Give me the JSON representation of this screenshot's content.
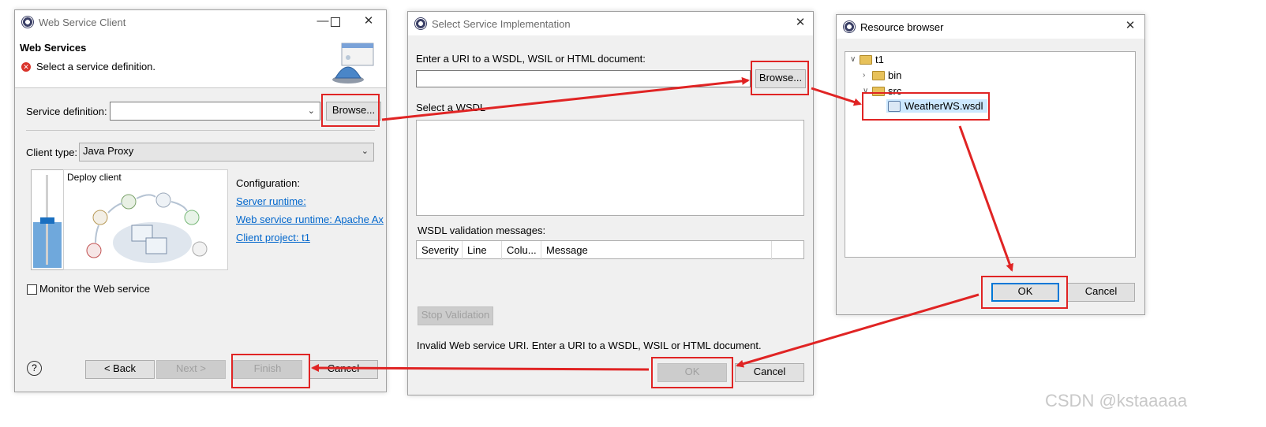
{
  "dialog1": {
    "title": "Web Service Client",
    "heading": "Web Services",
    "message": "Select a service definition.",
    "service_definition_label": "Service definition:",
    "service_definition_value": "",
    "browse_label": "Browse...",
    "client_type_label": "Client type:",
    "client_type_value": "Java Proxy",
    "slider_title": "Deploy client",
    "configuration_label": "Configuration:",
    "server_runtime_link": "Server runtime: ",
    "ws_runtime_link": "Web service runtime: Apache Ax",
    "client_project_link": "Client project: t1",
    "monitor_label": "Monitor the Web service",
    "back_label": "< Back",
    "next_label": "Next >",
    "finish_label": "Finish",
    "cancel_label": "Cancel",
    "help_glyph": "?"
  },
  "dialog2": {
    "title": "Select Service Implementation",
    "uri_label": "Enter a URI to a WSDL, WSIL or HTML document:",
    "uri_value": "",
    "browse_label": "Browse...",
    "select_wsdl_label": "Select a WSDL",
    "validation_label": "WSDL validation messages:",
    "columns": [
      "Severity",
      "Line",
      "Colu...",
      "Message"
    ],
    "stop_validation_label": "Stop Validation",
    "status_message": "Invalid Web service URI.  Enter a URI to a WSDL, WSIL or HTML document.",
    "ok_label": "OK",
    "cancel_label": "Cancel"
  },
  "dialog3": {
    "title": "Resource browser",
    "tree": {
      "root": "t1",
      "bin": "bin",
      "src": "src",
      "file": "WeatherWS.wsdl"
    },
    "ok_label": "OK",
    "cancel_label": "Cancel"
  },
  "watermark": "CSDN @kstaaaaa",
  "colors": {
    "highlight_box": "#e02424",
    "link": "#0066cc",
    "selection": "#cce8ff"
  }
}
